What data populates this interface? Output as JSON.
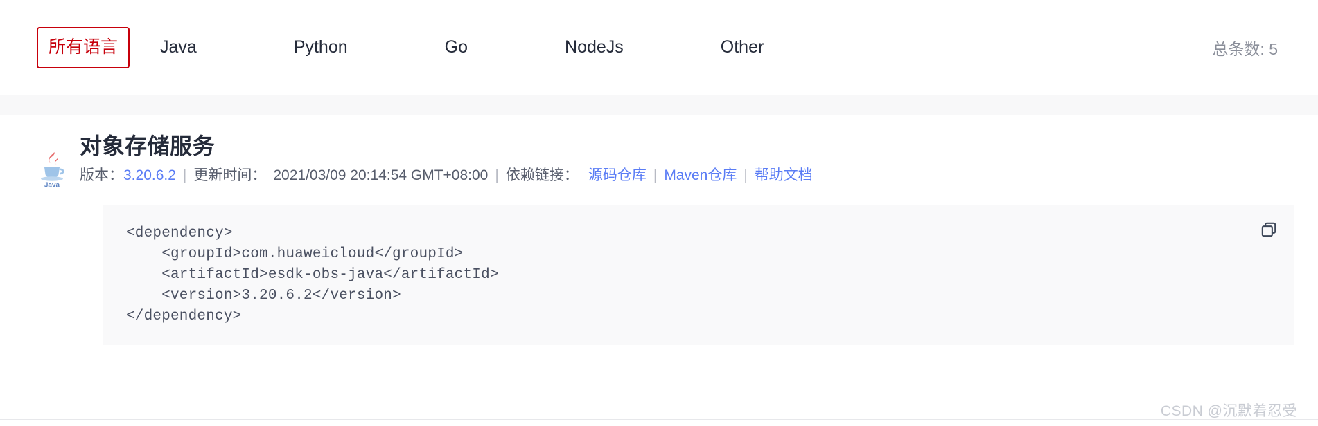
{
  "filter_bar": {
    "tabs": [
      {
        "label": "所有语言",
        "active": true
      },
      {
        "label": "Java",
        "active": false
      },
      {
        "label": "Python",
        "active": false
      },
      {
        "label": "Go",
        "active": false
      },
      {
        "label": "NodeJs",
        "active": false
      },
      {
        "label": "Other",
        "active": false
      }
    ],
    "total_count_text": "总条数: 5",
    "active_color": "#c7000b",
    "tab_text_color": "#252b3a",
    "count_color": "#8a8e99"
  },
  "result": {
    "icon_name": "java-logo-icon",
    "title": "对象存储服务",
    "meta": {
      "version_label": "版本：",
      "version_value": "3.20.6.2",
      "separator": "|",
      "update_label": "更新时间：",
      "update_value": "2021/03/09 20:14:54 GMT+08:00",
      "links_label": "依赖链接：",
      "links": [
        {
          "label": "源码仓库"
        },
        {
          "label": "Maven仓库"
        },
        {
          "label": "帮助文档"
        }
      ],
      "link_color": "#5a7cf5",
      "text_color": "#575d6c"
    },
    "code": {
      "copy_icon_name": "copy-icon",
      "background": "#f9f9fa",
      "text": "<dependency>\n    <groupId>com.huaweicloud</groupId>\n    <artifactId>esdk-obs-java</artifactId>\n    <version>3.20.6.2</version>\n</dependency>"
    }
  },
  "watermark": {
    "text": "CSDN @沉默着忍受",
    "color": "#c9ccd3"
  }
}
